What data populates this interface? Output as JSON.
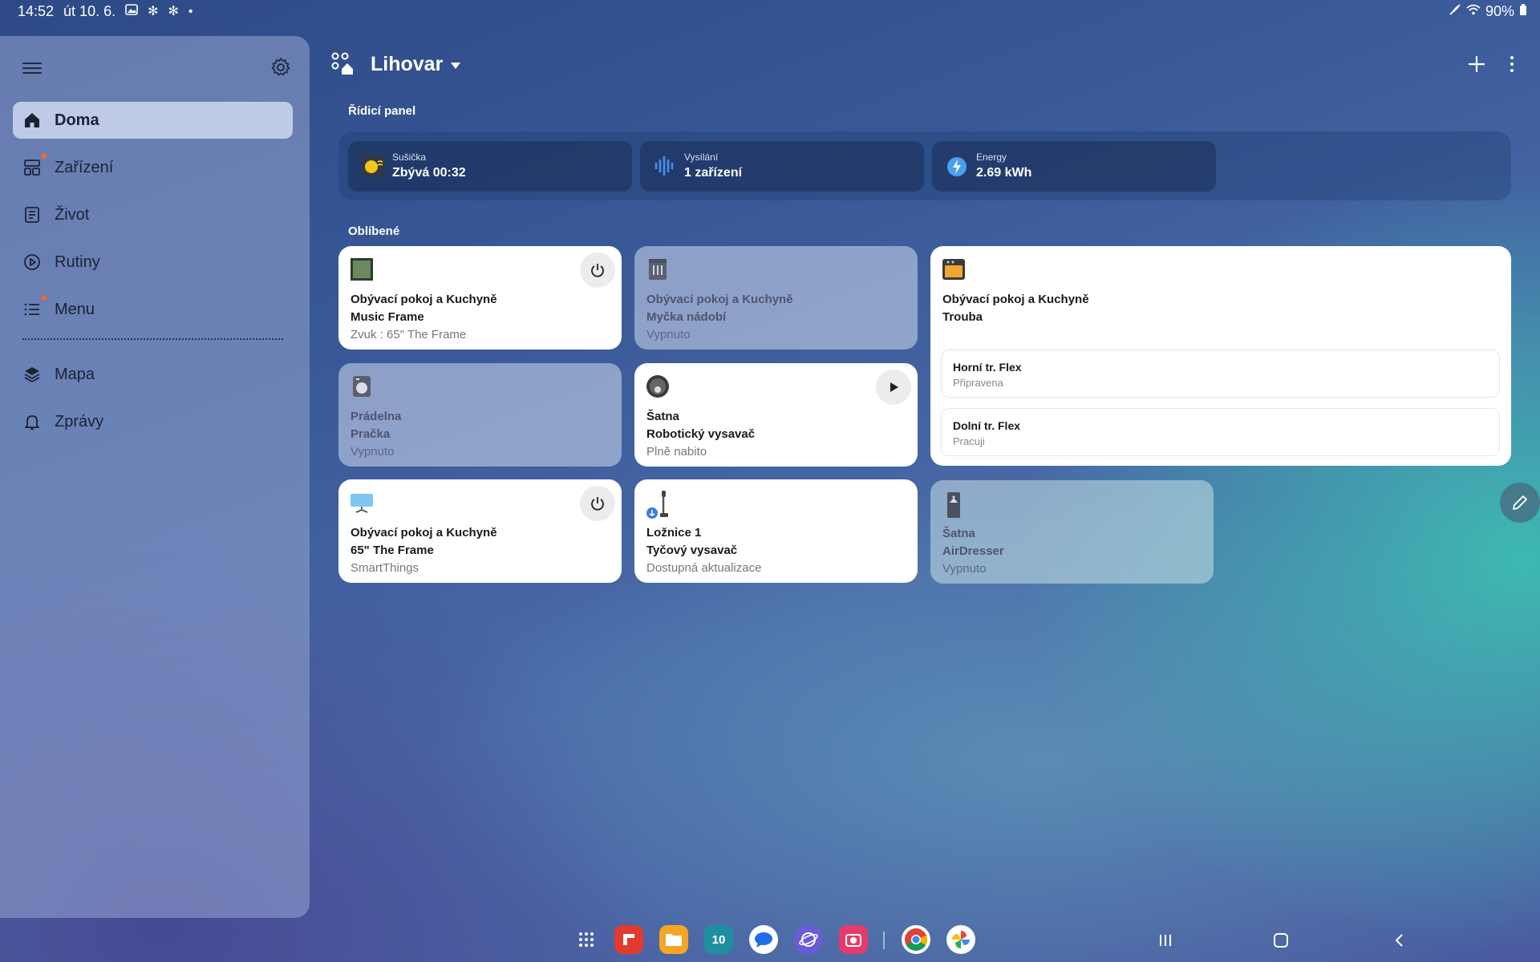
{
  "status": {
    "time": "14:52",
    "date": "út 10. 6.",
    "battery": "90%"
  },
  "sidebar": {
    "items": [
      {
        "label": "Doma",
        "icon": "home-icon"
      },
      {
        "label": "Zařízení",
        "icon": "devices-icon"
      },
      {
        "label": "Život",
        "icon": "life-icon"
      },
      {
        "label": "Rutiny",
        "icon": "routines-icon"
      },
      {
        "label": "Menu",
        "icon": "menu-list-icon"
      },
      {
        "label": "Mapa",
        "icon": "map-icon"
      },
      {
        "label": "Zprávy",
        "icon": "bell-icon"
      }
    ]
  },
  "header": {
    "home_name": "Lihovar"
  },
  "sections": {
    "control_panel": "Řídicí panel",
    "favorites": "Oblíbené"
  },
  "control_panel": [
    {
      "label": "Sušička",
      "value": "Zbývá 00:32",
      "icon": "dryer-icon"
    },
    {
      "label": "Vysílání",
      "value": "1 zařízení",
      "icon": "broadcast-icon"
    },
    {
      "label": "Energy",
      "value": "2.69 kWh",
      "icon": "energy-icon"
    }
  ],
  "favorites": {
    "music_frame": {
      "room": "Obývací pokoj a Kuchyně",
      "name": "Music Frame",
      "status": "Zvuk : 65\" The Frame"
    },
    "dishwasher": {
      "room": "Obývací pokoj a Kuchyně",
      "name": "Myčka nádobí",
      "status": "Vypnuto"
    },
    "oven": {
      "room": "Obývací pokoj a Kuchyně",
      "name": "Trouba",
      "zones": [
        {
          "name": "Horní tr. Flex",
          "status": "Připravena"
        },
        {
          "name": "Dolní tr. Flex",
          "status": "Pracuji"
        }
      ]
    },
    "washer": {
      "room": "Prádelna",
      "name": "Pračka",
      "status": "Vypnuto"
    },
    "robot_vacuum": {
      "room": "Šatna",
      "name": "Robotický vysavač",
      "status": "Plně nabito"
    },
    "tv": {
      "room": "Obývací pokoj a Kuchyně",
      "name": "65\" The Frame",
      "status": "SmartThings"
    },
    "stick_vacuum": {
      "room": "Ložnice 1",
      "name": "Tyčový vysavač",
      "status": "Dostupná aktualizace"
    },
    "airdresser": {
      "room": "Šatna",
      "name": "AirDresser",
      "status": "Vypnuto"
    }
  },
  "taskbar": {
    "calendar_day": "10"
  },
  "colors": {
    "notification_dot": "#f0643c",
    "card_white": "#ffffff"
  }
}
